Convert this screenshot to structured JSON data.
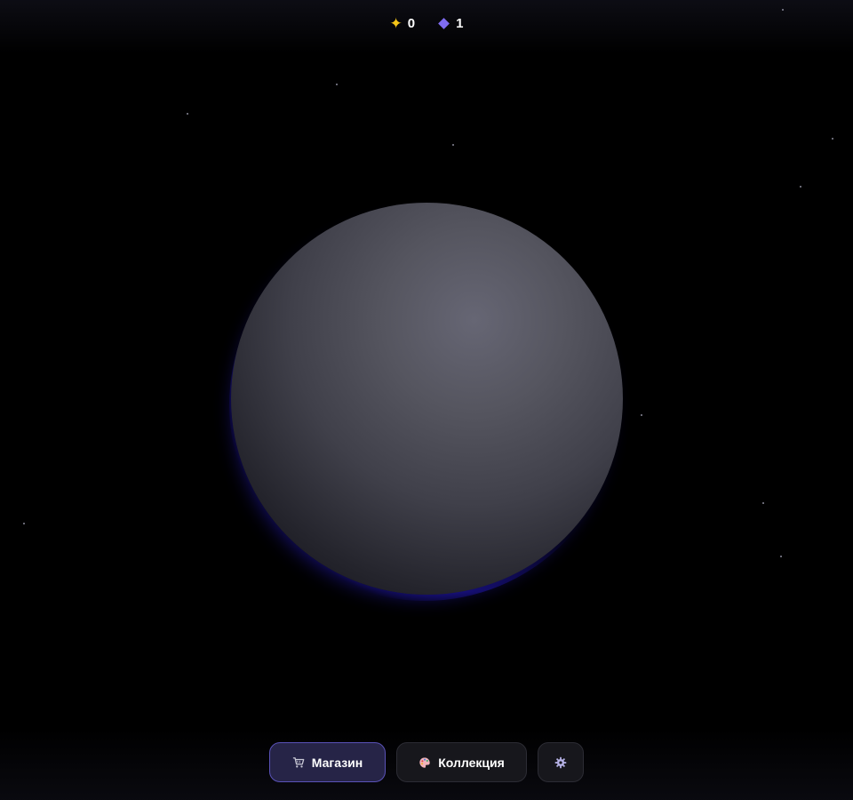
{
  "hud": {
    "stars_count": "0",
    "gems_count": "1"
  },
  "nav": {
    "shop_label": "Магазин",
    "collection_label": "Коллекция"
  },
  "icons": {
    "stars": "star-icon",
    "gems": "gem-icon",
    "shop": "cart-icon",
    "collection": "palette-icon",
    "settings": "gear-icon"
  },
  "colors": {
    "star_yellow": "#f5c518",
    "gem_purple": "#7f6cf2",
    "shop_button_bg": "#262447",
    "shop_button_border": "#5a52b8",
    "planet": "#55555f"
  }
}
